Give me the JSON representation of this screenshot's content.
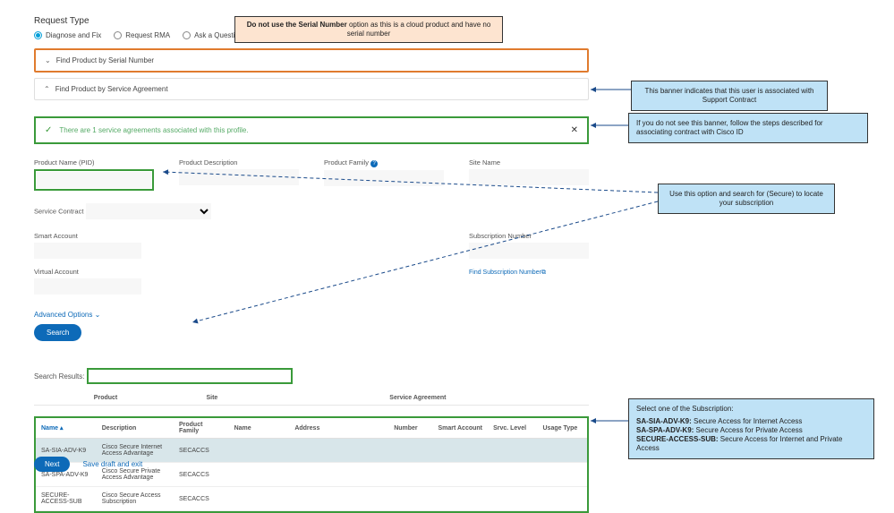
{
  "title": "Request Type",
  "radios": {
    "diagnose": "Diagnose and Fix",
    "rma": "Request RMA",
    "ask": "Ask a Question"
  },
  "accordion": {
    "serial": "Find Product by Serial Number",
    "service": "Find Product by Service Agreement"
  },
  "banner": {
    "text": "There are 1 service agreements associated with this profile."
  },
  "labels": {
    "pid": "Product Name (PID)",
    "desc": "Product Description",
    "family": "Product Family",
    "site": "Site Name",
    "contract": "Service Contract",
    "smart": "Smart Account",
    "virtual": "Virtual Account",
    "subnum": "Subscription Number",
    "findsub": "Find Subscription Number",
    "advanced": "Advanced Options",
    "search": "Search",
    "results": "Search Results:"
  },
  "table": {
    "group_product": "Product",
    "group_site": "Site",
    "group_agreement": "Service Agreement",
    "cols": {
      "name": "Name",
      "desc": "Description",
      "family": "Product Family",
      "sitename": "Name",
      "address": "Address",
      "number": "Number",
      "smart": "Smart Account",
      "level": "Srvc. Level",
      "usage": "Usage Type"
    },
    "rows": [
      {
        "name": "SA-SIA-ADV-K9",
        "desc": "Cisco Secure Internet Access Advantage",
        "family": "SECACCS"
      },
      {
        "name": "SA-SPA-ADV-K9",
        "desc": "Cisco Secure Private Access Advantage",
        "family": "SECACCS"
      },
      {
        "name": "SECURE-ACCESS-SUB",
        "desc": "Cisco Secure Access Subscription",
        "family": "SECACCS"
      }
    ]
  },
  "footer": {
    "next": "Next",
    "save": "Save draft and exit"
  },
  "callouts": {
    "top_pre": "Do not use the Serial Number ",
    "top_post": "option as this is a cloud product and have no serial number",
    "banner1": "This banner indicates that this user is associated with Support Contract",
    "banner2": "If you do not see this banner, follow the steps described for associating contract with Cisco ID",
    "pid": "Use this option and search for (Secure) to locate your subscription",
    "sub_title": "Select one of the Subscription:",
    "sub1a": "SA-SIA-ADV-K9: ",
    "sub1b": "Secure Access for Internet Access",
    "sub2a": "SA-SPA-ADV-K9: ",
    "sub2b": "Secure Access for Private Access",
    "sub3a": "SECURE-ACCESS-SUB: ",
    "sub3b": "Secure Access for Internet and Private Access"
  }
}
